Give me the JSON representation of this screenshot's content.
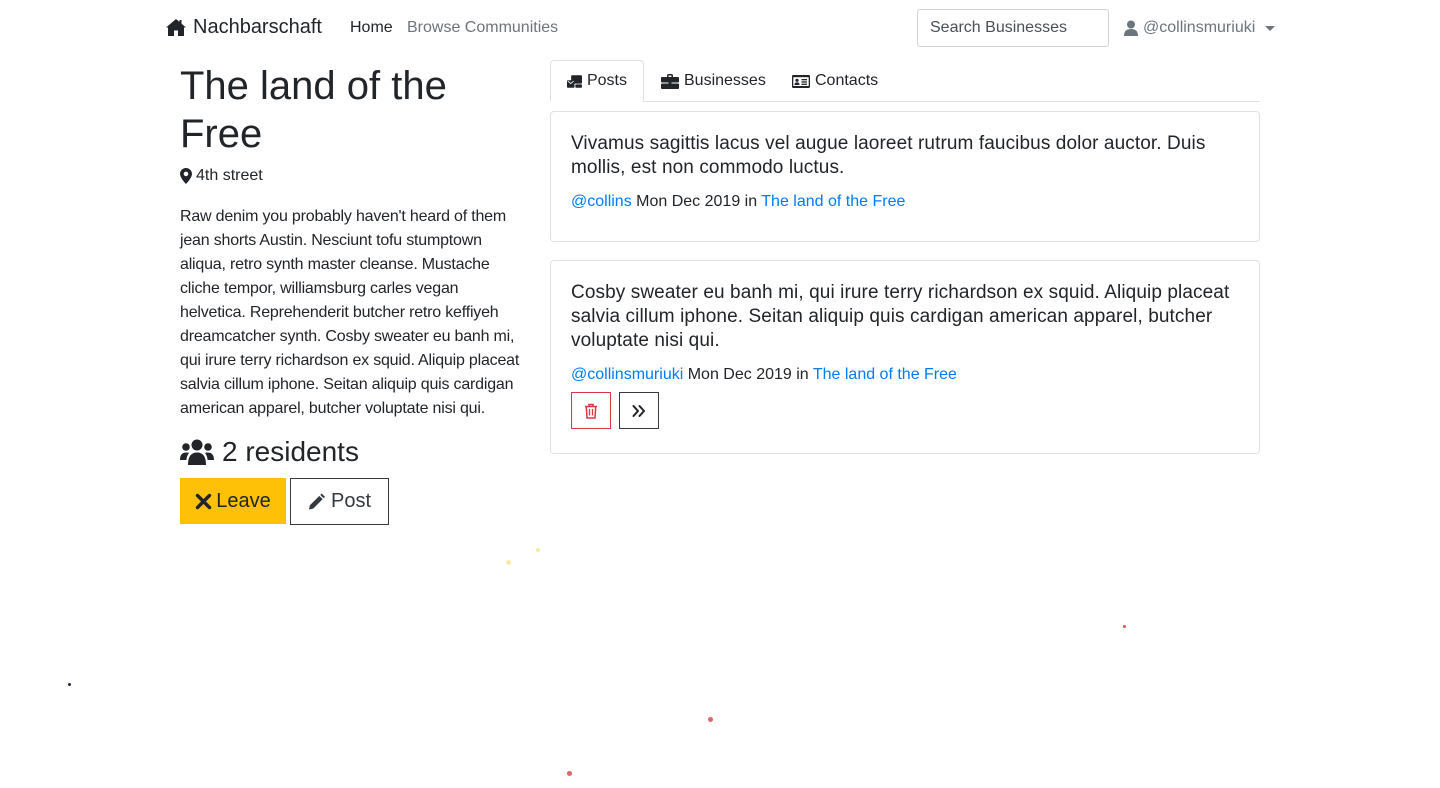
{
  "navbar": {
    "brand": "Nachbarschaft",
    "links": {
      "home": "Home",
      "browse": "Browse Communities"
    },
    "search_placeholder": "Search Businesses",
    "user": "@collinsmuriuki"
  },
  "community": {
    "name": "The land of the Free",
    "location": "4th street",
    "description": "Raw denim you probably haven't heard of them jean shorts Austin. Nesciunt tofu stumptown aliqua, retro synth master cleanse. Mustache cliche tempor, williamsburg carles vegan helvetica. Reprehenderit butcher retro keffiyeh dreamcatcher synth. Cosby sweater eu banh mi, qui irure terry richardson ex squid. Aliquip placeat salvia cillum iphone. Seitan aliquip quis cardigan american apparel, butcher voluptate nisi qui.",
    "residents": "2 residents",
    "buttons": {
      "leave": "Leave",
      "post": "Post"
    }
  },
  "tabs": [
    {
      "label": "Posts",
      "icon": "mail-bulk-icon",
      "active": true
    },
    {
      "label": "Businesses",
      "icon": "briefcase-icon",
      "active": false
    },
    {
      "label": "Contacts",
      "icon": "address-card-icon",
      "active": false
    }
  ],
  "posts": [
    {
      "body": "Vivamus sagittis lacus vel augue laoreet rutrum faucibus dolor auctor. Duis mollis, est non commodo luctus.",
      "author": "@collins",
      "date": "Mon Dec 2019",
      "in": "in",
      "community": "The land of the Free"
    },
    {
      "body": "Cosby sweater eu banh mi, qui irure terry richardson ex squid. Aliquip placeat salvia cillum iphone. Seitan aliquip quis cardigan american apparel, butcher voluptate nisi qui.",
      "author": "@collinsmuriuki",
      "date": "Mon Dec 2019",
      "in": "in",
      "community": "The land of the Free"
    }
  ],
  "colors": {
    "link": "#007bff",
    "warning": "#ffc107",
    "danger": "#dc3545",
    "muted": "#6c757d",
    "dark": "#212529"
  }
}
